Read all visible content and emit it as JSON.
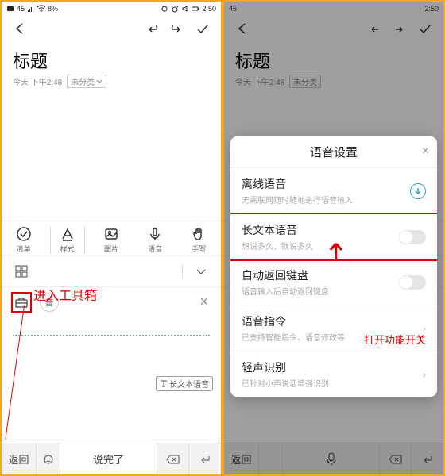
{
  "status": {
    "time": "2:50",
    "net": "45",
    "kbs": "8%"
  },
  "note": {
    "title": "标题",
    "date": "今天 下午2:48",
    "category": "未分类"
  },
  "callouts": {
    "left": "进入工具箱",
    "right": "打开功能开关"
  },
  "format_tabs": {
    "list": {
      "label": "清单"
    },
    "style": {
      "label": "样式"
    },
    "image": {
      "label": "图片"
    },
    "voice": {
      "label": "语音"
    },
    "hand": {
      "label": "手写"
    }
  },
  "pu_badge": "普",
  "voice_badge": "长文本语音",
  "keyboard": {
    "return": "返回",
    "done": "说完了"
  },
  "popup": {
    "title": "语音设置",
    "rows": {
      "offline": {
        "title": "离线语音",
        "sub": "无需联网随时随地进行语音输入"
      },
      "longtext": {
        "title": "长文本语音",
        "sub": "想说多久，就说多久"
      },
      "autoback": {
        "title": "自动返回键盘",
        "sub": "语音输入后自动返回键盘"
      },
      "cmd": {
        "title": "语音指令",
        "sub": "已支持智能指令、语音修改等"
      },
      "soft": {
        "title": "轻声识别",
        "sub": "已针对小声说话增强识别"
      }
    }
  }
}
